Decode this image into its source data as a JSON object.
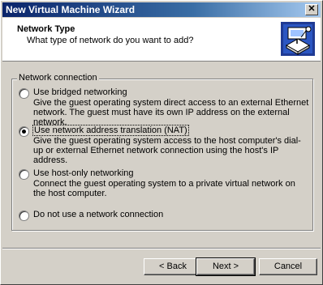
{
  "window": {
    "title": "New Virtual Machine Wizard",
    "close_glyph": "✕"
  },
  "header": {
    "title": "Network Type",
    "subtitle": "What type of network do you want to add?",
    "icon": "network-wizard-icon"
  },
  "group": {
    "legend": "Network connection",
    "options": [
      {
        "label": "Use bridged networking",
        "description": "Give the guest operating system direct access to an external Ethernet network. The guest must have its own IP address on the external network.",
        "checked": false
      },
      {
        "label": "Use network address translation (NAT)",
        "description": "Give the guest operating system access to the host computer's dial-up or external Ethernet network connection using the host's IP address.",
        "checked": true
      },
      {
        "label": "Use host-only networking",
        "description": "Connect the guest operating system to a private virtual network on the host computer.",
        "checked": false
      },
      {
        "label": "Do not use a network connection",
        "description": "",
        "checked": false
      }
    ]
  },
  "buttons": {
    "back": "< Back",
    "next": "Next >",
    "cancel": "Cancel"
  }
}
